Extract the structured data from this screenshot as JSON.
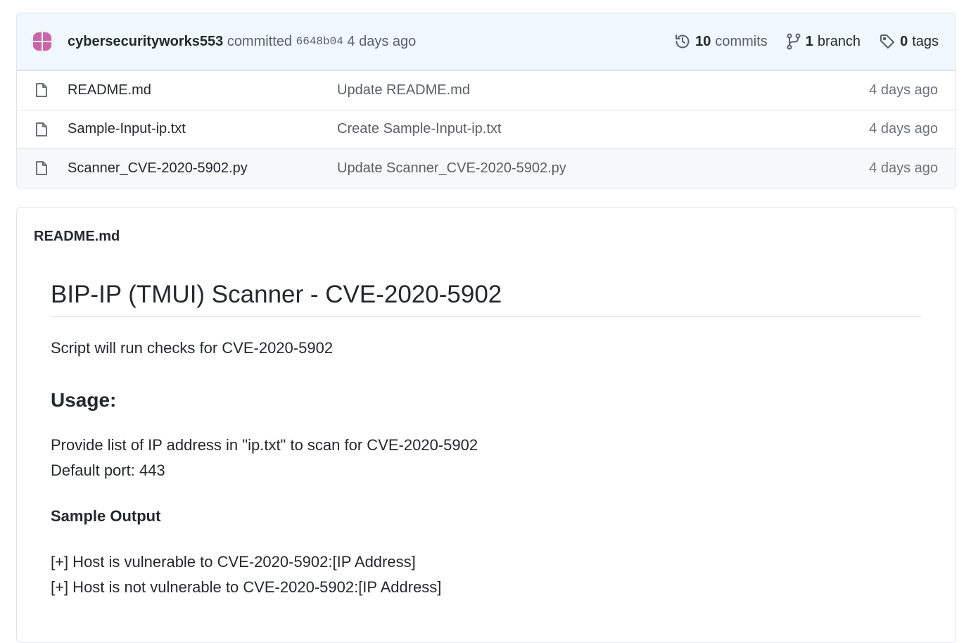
{
  "commit_bar": {
    "author": "cybersecurityworks553",
    "action": "committed",
    "sha": "6648b04",
    "time": "4 days ago",
    "commits": {
      "count": "10",
      "label": "commits",
      "icon": "history-icon"
    },
    "branches": {
      "count": "1",
      "label": "branch",
      "icon": "git-branch-icon"
    },
    "tags": {
      "count": "0",
      "label": "tags",
      "icon": "tag-icon"
    }
  },
  "files": [
    {
      "name": "README.md",
      "message": "Update README.md",
      "age": "4 days ago",
      "icon": "file-icon"
    },
    {
      "name": "Sample-Input-ip.txt",
      "message": "Create Sample-Input-ip.txt",
      "age": "4 days ago",
      "icon": "file-icon"
    },
    {
      "name": "Scanner_CVE-2020-5902.py",
      "message": "Update Scanner_CVE-2020-5902.py",
      "age": "4 days ago",
      "icon": "file-icon"
    }
  ],
  "readme": {
    "filename": "README.md",
    "title": "BIP-IP (TMUI) Scanner - CVE-2020-5902",
    "intro": "Script will run checks for CVE-2020-5902",
    "usage_heading": "Usage:",
    "usage_lines": [
      "Provide list of IP address in \"ip.txt\" to scan for CVE-2020-5902",
      "Default port: 443"
    ],
    "sample_heading": "Sample Output",
    "sample_lines": [
      "[+] Host is vulnerable to CVE-2020-5902:[IP Address]",
      "[+] Host is not vulnerable to CVE-2020-5902:[IP Address]"
    ]
  },
  "colors": {
    "commit_bar_bg": "#f1f8ff",
    "commit_bar_border": "#c8e1ff",
    "avatar_color": "#c767a9",
    "muted_text": "#586069"
  }
}
